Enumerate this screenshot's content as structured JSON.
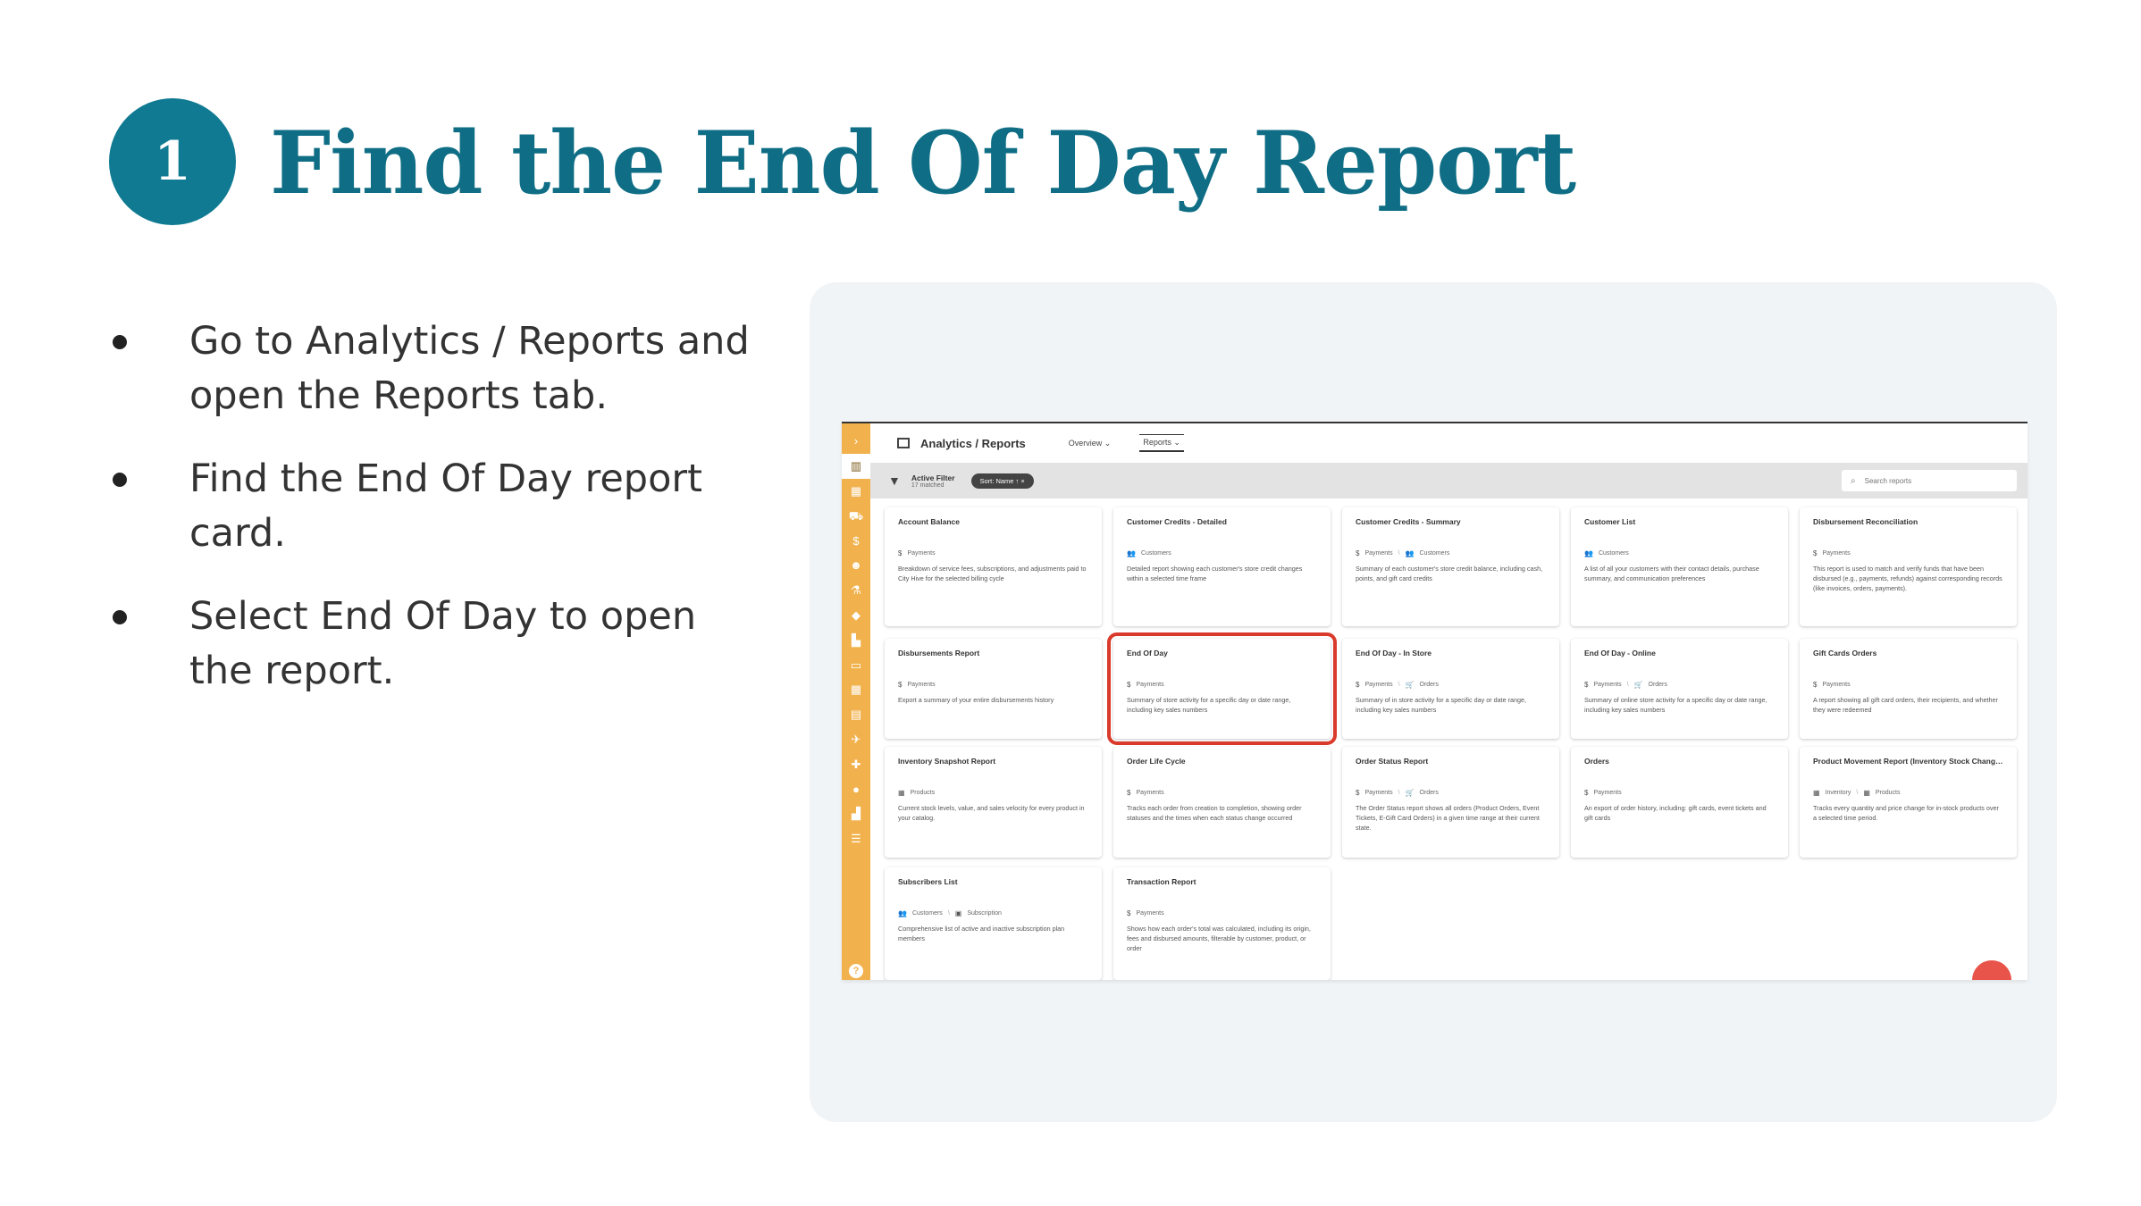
{
  "slide": {
    "step_number": "1",
    "title": "Find the End Of Day Report",
    "bullets": [
      "Go to Analytics / Reports and open the Reports tab.",
      "Find the End Of Day report card.",
      "Select End Of Day to open the report."
    ]
  },
  "app": {
    "header": {
      "title": "Analytics / Reports",
      "tabs": [
        {
          "label": "Overview ⌄",
          "selected": false
        },
        {
          "label": "Reports ⌄",
          "selected": true
        }
      ]
    },
    "filter": {
      "label": "Active Filter",
      "count": "17 matched",
      "chip": "Sort: Name  ↑  ×"
    },
    "search": {
      "placeholder": "Search reports"
    },
    "sidebar_icons": [
      "chevron-right-icon",
      "analytics-icon",
      "grid-icon",
      "cart-icon",
      "dollar-icon",
      "users-icon",
      "flask-icon",
      "tag-icon",
      "building-icon",
      "ticket-icon",
      "calendar-icon",
      "book-icon",
      "plane-icon",
      "puzzle-icon",
      "lightbulb-icon",
      "house-icon",
      "database-icon"
    ],
    "colors": {
      "sidebar": "#f1b24d",
      "highlight": "#d93a2b",
      "accent": "#0f7a92"
    },
    "cards": [
      {
        "title": "Account Balance",
        "tags": [
          "Payments"
        ],
        "tag_icons": [
          "$"
        ],
        "desc": "Breakdown of service fees, subscriptions, and adjustments paid to City Hive for the selected billing cycle"
      },
      {
        "title": "Customer Credits - Detailed",
        "tags": [
          "Customers"
        ],
        "tag_icons": [
          "👥"
        ],
        "desc": "Detailed report showing each customer's store credit changes within a selected time frame"
      },
      {
        "title": "Customer Credits - Summary",
        "tags": [
          "Payments",
          "Customers"
        ],
        "tag_icons": [
          "$",
          "👥"
        ],
        "desc": "Summary of each customer's store credit balance, including cash, points, and gift card credits"
      },
      {
        "title": "Customer List",
        "tags": [
          "Customers"
        ],
        "tag_icons": [
          "👥"
        ],
        "desc": "A list of all your customers with their contact details, purchase summary, and communication preferences"
      },
      {
        "title": "Disbursement Reconciliation",
        "tags": [
          "Payments"
        ],
        "tag_icons": [
          "$"
        ],
        "desc": "This report is used to match and verify funds that have been disbursed (e.g., payments, refunds) against corresponding records (like invoices, orders, payments)."
      },
      {
        "title": "Disbursements Report",
        "tags": [
          "Payments"
        ],
        "tag_icons": [
          "$"
        ],
        "desc": "Export a summary of your entire disbursements history"
      },
      {
        "title": "End Of Day",
        "tags": [
          "Payments"
        ],
        "tag_icons": [
          "$"
        ],
        "desc": "Summary of store activity for a specific day or date range, including key sales numbers",
        "highlight": true
      },
      {
        "title": "End Of Day - In Store",
        "tags": [
          "Payments",
          "Orders"
        ],
        "tag_icons": [
          "$",
          "🛒"
        ],
        "desc": "Summary of in store activity for a specific day or date range, including key sales numbers"
      },
      {
        "title": "End Of Day - Online",
        "tags": [
          "Payments",
          "Orders"
        ],
        "tag_icons": [
          "$",
          "🛒"
        ],
        "desc": "Summary of online store activity for a specific day or date range, including key sales numbers"
      },
      {
        "title": "Gift Cards Orders",
        "tags": [
          "Payments"
        ],
        "tag_icons": [
          "$"
        ],
        "desc": "A report showing all gift card orders, their recipients, and whether they were redeemed"
      },
      {
        "title": "Inventory Snapshot Report",
        "tags": [
          "Products"
        ],
        "tag_icons": [
          "▦"
        ],
        "desc": "Current stock levels, value, and sales velocity for every product in your catalog."
      },
      {
        "title": "Order Life Cycle",
        "tags": [
          "Payments"
        ],
        "tag_icons": [
          "$"
        ],
        "desc": "Tracks each order from creation to completion, showing order statuses and the times when each status change occurred"
      },
      {
        "title": "Order Status Report",
        "tags": [
          "Payments",
          "Orders"
        ],
        "tag_icons": [
          "$",
          "🛒"
        ],
        "desc": "The Order Status report shows all orders (Product Orders, Event Tickets, E-Gift Card Orders) in a given time range at their current state."
      },
      {
        "title": "Orders",
        "tags": [
          "Payments"
        ],
        "tag_icons": [
          "$"
        ],
        "desc": "An export of order history, including: gift cards, event tickets and gift cards"
      },
      {
        "title": "Product Movement Report (Inventory Stock Changes)",
        "tags": [
          "Inventory",
          "Products"
        ],
        "tag_icons": [
          "▦",
          "▦"
        ],
        "desc": "Tracks every quantity and price change for in-stock products over a selected time period."
      },
      {
        "title": "Subscribers List",
        "tags": [
          "Customers",
          "Subscription"
        ],
        "tag_icons": [
          "👥",
          "▣"
        ],
        "desc": "Comprehensive list of active and inactive subscription plan members"
      },
      {
        "title": "Transaction Report",
        "tags": [
          "Payments"
        ],
        "tag_icons": [
          "$"
        ],
        "desc": "Shows how each order's total was calculated, including its origin, fees and disbursed amounts, filterable by customer, product, or order"
      }
    ]
  }
}
